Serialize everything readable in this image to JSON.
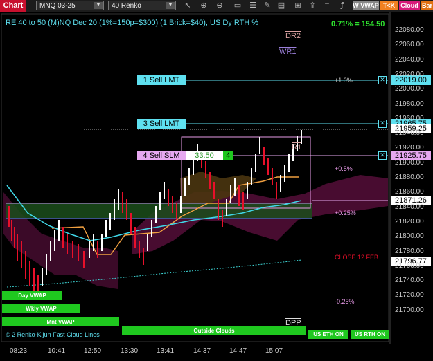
{
  "toolbar": {
    "chart_label": "Chart",
    "instrument": "MNQ 03-25",
    "bar_type": "40 Renko",
    "buttons": [
      "W VWAP",
      "T<K",
      "Cloud",
      "Bar"
    ]
  },
  "header": {
    "title": "RE 40 to 50 (M)NQ Dec 20 (1%=150p=$300) (1 Brick=$40), US Dy RTH %",
    "change": "0.71% = 154.50"
  },
  "levels": {
    "dr2": "DR2",
    "wr1": "WR1",
    "r1": "R1",
    "dpp": "DPP",
    "pct_1": "+1.0%",
    "pct_05": "+0.5%",
    "pct_025": "+0.25%",
    "pct_neg025": "-0.25%",
    "close_label": "CLOSE 12 FEB"
  },
  "orders": {
    "sell_lmt_1": "1 Sell LMT",
    "sell_lmt_3": "3 Sell LMT",
    "sell_slm_4": "4 Sell SLM",
    "slm_price": "33.50",
    "slm_qty": "4"
  },
  "price_tags": {
    "p1": "22019.00",
    "p2": "21965.75",
    "current": "21959.25",
    "p3": "21925.75",
    "p4": "21871.26",
    "p5": "21796.77"
  },
  "price_axis": [
    "22080.00",
    "22060.00",
    "22040.00",
    "22020.00",
    "22000.00",
    "21980.00",
    "21960.00",
    "21940.00",
    "21920.00",
    "21900.00",
    "21880.00",
    "21860.00",
    "21840.00",
    "21820.00",
    "21800.00",
    "21780.00",
    "21760.00",
    "21740.00",
    "21720.00",
    "21700.00"
  ],
  "time_axis": [
    "08:23",
    "10:41",
    "12:50",
    "13:30",
    "13:41",
    "14:37",
    "14:47",
    "15:07"
  ],
  "legend": {
    "day_vwap": "Day VWAP",
    "wkly_vwap": "Wkly VWAP",
    "mnt_vwap": "Mnt VWAP",
    "outside_clouds": "Outside Clouds",
    "us_eth_on": "US ETH ON",
    "us_rth_on": "US RTH ON",
    "footer": "© 2 Renko-Kijun Fast Cloud Lines"
  },
  "colors": {
    "accent_cyan": "#5ee0f0",
    "slm_pink": "#e6a8f0",
    "green": "#1fc81f",
    "red": "#e8102a",
    "white": "#ffffff"
  }
}
